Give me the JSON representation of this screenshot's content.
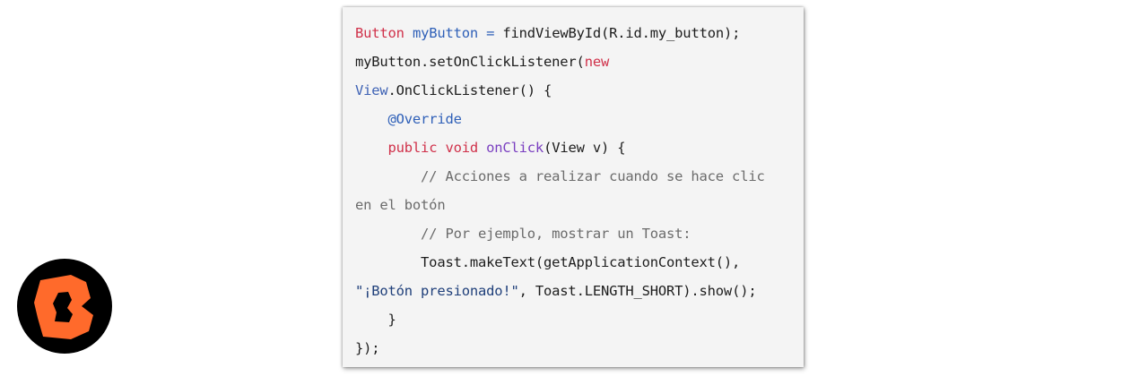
{
  "colors": {
    "keyword": "#d0314a",
    "variable": "#2f60b8",
    "method": "#7a3fc0",
    "comment": "#6b6b6b",
    "string": "#1f3f7a",
    "default": "#1d1d1d",
    "logo_orange": "#ff6a2b",
    "logo_bg": "#000000"
  },
  "logo": {
    "icon": "stylized-b-logo-icon"
  },
  "code": {
    "lines": [
      [
        {
          "t": "Button",
          "c": "keyword"
        },
        {
          "t": " ",
          "c": "default"
        },
        {
          "t": "myButton",
          "c": "variable"
        },
        {
          "t": " ",
          "c": "default"
        },
        {
          "t": "=",
          "c": "variable"
        },
        {
          "t": " findViewById(R.id.my_button);",
          "c": "default"
        }
      ],
      [
        {
          "t": "myButton.setOnClickListener(",
          "c": "default"
        },
        {
          "t": "new",
          "c": "keyword"
        }
      ],
      [
        {
          "t": "View",
          "c": "type"
        },
        {
          "t": ".OnClickListener() {",
          "c": "default"
        }
      ],
      [
        {
          "t": "    ",
          "c": "default"
        },
        {
          "t": "@Override",
          "c": "annotation"
        }
      ],
      [
        {
          "t": "    ",
          "c": "default"
        },
        {
          "t": "public",
          "c": "keyword"
        },
        {
          "t": " ",
          "c": "default"
        },
        {
          "t": "void",
          "c": "keyword"
        },
        {
          "t": " ",
          "c": "default"
        },
        {
          "t": "onClick",
          "c": "method"
        },
        {
          "t": "(View v) {",
          "c": "default"
        }
      ],
      [
        {
          "t": "        // Acciones a realizar cuando se hace clic",
          "c": "comment"
        }
      ],
      [
        {
          "t": "en el botón",
          "c": "comment"
        }
      ],
      [
        {
          "t": "        // Por ejemplo, mostrar un Toast:",
          "c": "comment"
        }
      ],
      [
        {
          "t": "        Toast.makeText(getApplicationContext(),",
          "c": "default"
        }
      ],
      [
        {
          "t": "\"¡Botón presionado!\"",
          "c": "string"
        },
        {
          "t": ", Toast.LENGTH_SHORT).show();",
          "c": "default"
        }
      ],
      [
        {
          "t": "    }",
          "c": "default"
        }
      ],
      [
        {
          "t": "});",
          "c": "default"
        }
      ]
    ]
  }
}
